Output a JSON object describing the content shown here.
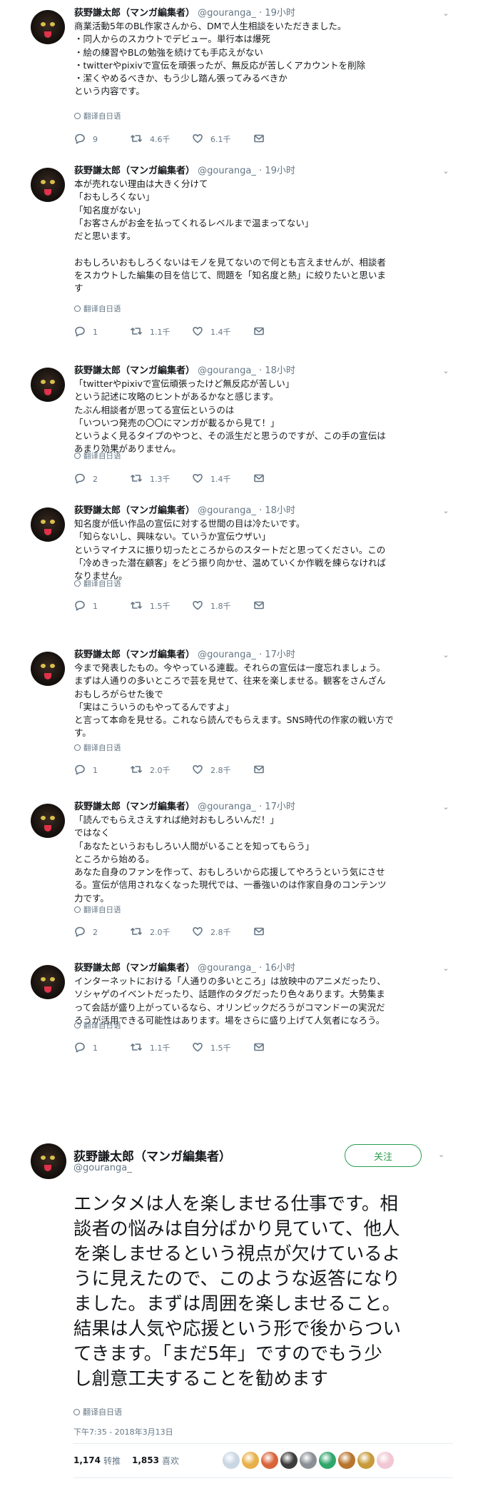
{
  "author": {
    "name": "荻野謙太郎（マンガ編集者）",
    "handle": "@gouranga_",
    "handle_plain": "@gouranga_",
    "dot": "·"
  },
  "translate_label": "翻译自日语",
  "tweets": [
    {
      "time": "19小时",
      "lines": [
        "商業活動5年のBL作家さんから、DMで人生相談をいただきました。",
        "・同人からのスカウトでデビュー。単行本は爆死",
        "・絵の練習やBLの勉強を続けても手応えがない",
        "・twitterやpixivで宣伝を頑張ったが、無反応が苦しくアカウントを削除",
        "・潔くやめるべきか、もう少し踏ん張ってみるべきか",
        "という内容です。"
      ],
      "replies": "9",
      "retweets": "4.6千",
      "likes": "6.1千"
    },
    {
      "time": "19小时",
      "lines": [
        "本が売れない理由は大きく分けて",
        "「おもしろくない」",
        "「知名度がない」",
        "「お客さんがお金を払ってくれるレベルまで温まってない」",
        "だと思います。",
        "",
        "おもしろいおもしろくないはモノを見てないので何とも言えませんが、相談者",
        "をスカウトした編集の目を信じて、問題を「知名度と熱」に絞りたいと思いま",
        "す"
      ],
      "replies": "1",
      "retweets": "1.1千",
      "likes": "1.4千"
    },
    {
      "time": "18小时",
      "lines": [
        "「twitterやpixivで宣伝頑張ったけど無反応が苦しい」",
        "という記述に攻略のヒントがあるかなと感じます。",
        "たぶん相談者が思ってる宣伝というのは",
        "「いついつ発売の〇〇にマンガが載るから見て！」",
        "というよく見るタイプのやつと、その派生だと思うのですが、この手の宣伝は",
        "あまり効果がありません。"
      ],
      "replies": "2",
      "retweets": "1.3千",
      "likes": "1.4千"
    },
    {
      "time": "18小时",
      "lines": [
        "知名度が低い作品の宣伝に対する世間の目は冷たいです。",
        "「知らないし、興味ない。ていうか宣伝ウザい」",
        "というマイナスに振り切ったところからのスタートだと思ってください。この",
        "「冷めきった潜在顧客」をどう振り向かせ、温めていくか作戦を練らなければ",
        "なりません。"
      ],
      "replies": "1",
      "retweets": "1.5千",
      "likes": "1.8千"
    },
    {
      "time": "17小时",
      "lines": [
        "今まで発表したもの。今やっている連載。それらの宣伝は一度忘れましょう。",
        "まずは人通りの多いところで芸を見せて、往来を楽しませる。観客をさんざん",
        "おもしろがらせた後で",
        "「実はこういうのもやってるんですよ」",
        "と言って本命を見せる。これなら読んでもらえます。SNS時代の作家の戦い方で",
        "す。"
      ],
      "replies": "1",
      "retweets": "2.0千",
      "likes": "2.8千"
    },
    {
      "time": "17小时",
      "lines": [
        "「読んでもらえさえすれば絶対おもしろいんだ！」",
        "ではなく",
        "「あなたというおもしろい人間がいることを知ってもらう」",
        "ところから始める。",
        "あなた自身のファンを作って、おもしろいから応援してやろうという気にさせ",
        "る。宣伝が信用されなくなった現代では、一番強いのは作家自身のコンテンツ",
        "力です。"
      ],
      "replies": "2",
      "retweets": "2.0千",
      "likes": "2.8千"
    },
    {
      "time": "16小时",
      "lines": [
        "インターネットにおける「人通りの多いところ」は放映中のアニメだったり、",
        "ソシャゲのイベントだったり、話題作のタグだったり色々あります。大勢集ま",
        "って会話が盛り上がっているなら、オリンピックだろうがコマンドーの実況だ",
        "ろうが活用できる可能性はあります。場をさらに盛り上げて人気者になろう。"
      ],
      "replies": "1",
      "retweets": "1.1千",
      "likes": "1.5千"
    }
  ],
  "focus": {
    "follow_label": "关注",
    "lines": [
      "エンタメは人を楽しませる仕事です。相",
      "談者の悩みは自分ばかり見ていて、他人",
      "を楽しませるという視点が欠けているよ",
      "うに見えたので、このような返答になり",
      "ました。まずは周囲を楽しませること。",
      "結果は人気や応援という形で後からつい",
      "てきます。「まだ5年」ですのでもう少",
      "し創意工夫することを勧めます"
    ],
    "timestamp": "下午7:35 - 2018年3月13日",
    "retweet_count": "1,174",
    "retweet_label": "转推",
    "like_count": "1,853",
    "like_label": "喜欢"
  },
  "colors": {
    "follow_accent": "#2a9d4f",
    "meta_gray": "#657786",
    "liker_avatars": [
      "#c9d6e3",
      "#e8b04a",
      "#d9643a",
      "#3d3d3d",
      "#8a8f96",
      "#2fa66a",
      "#b8742c",
      "#c79a3a",
      "#f0c7d2"
    ]
  }
}
